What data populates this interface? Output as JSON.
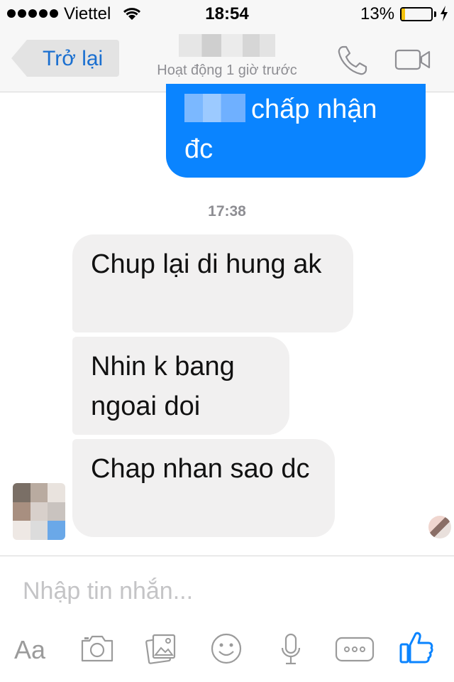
{
  "status_bar": {
    "carrier": "Viettel",
    "time": "18:54",
    "battery_percent": "13%",
    "battery_level": 0.13,
    "battery_color": "#f4c20d",
    "icons": [
      "signal-dots-icon",
      "wifi-icon",
      "battery-icon",
      "charging-icon"
    ]
  },
  "header": {
    "back_label": "Trở lại",
    "activity_status": "Hoạt động 1 giờ trước",
    "accent_color": "#1a6fd0",
    "icons": [
      "phone-call-icon",
      "video-call-icon"
    ]
  },
  "conversation": {
    "outgoing": {
      "text": "chấp nhận đc",
      "color": "#0a84ff"
    },
    "timestamp": "17:38",
    "incoming": [
      {
        "text": "Chup lại di hung ak"
      },
      {
        "text": "Nhin k bang ngoai doi"
      },
      {
        "text": "Chap nhan sao dc"
      }
    ],
    "incoming_color": "#f1f0f0"
  },
  "composer": {
    "placeholder": "Nhập tin nhắn...",
    "aa_label": "Aa",
    "icons": [
      "text-format-icon",
      "camera-icon",
      "photo-gallery-icon",
      "emoji-icon",
      "microphone-icon",
      "more-icon",
      "thumbs-up-icon"
    ],
    "like_color": "#0a84ff"
  }
}
